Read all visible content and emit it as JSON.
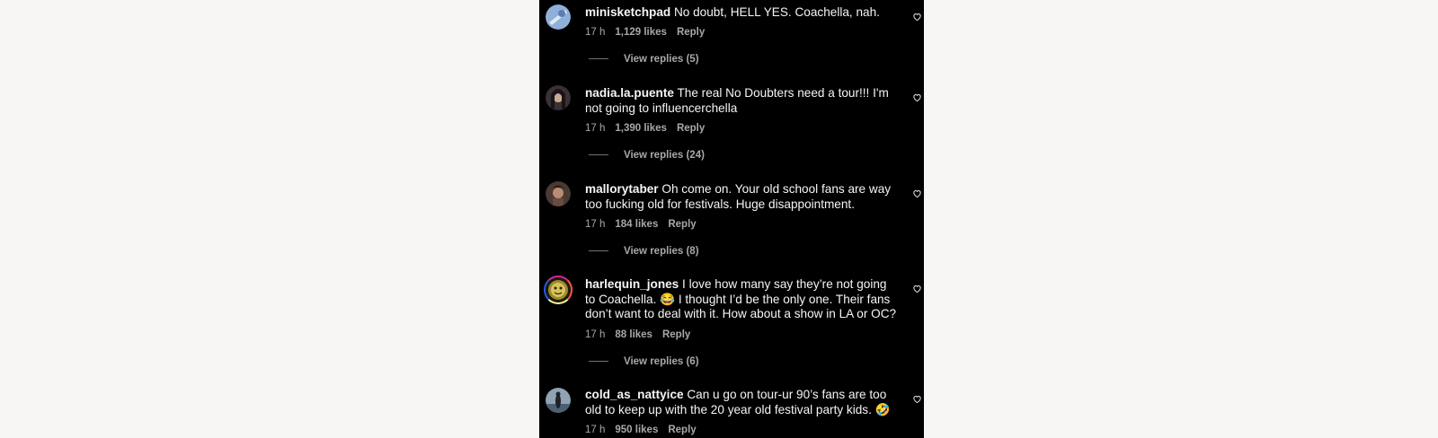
{
  "comments": [
    {
      "username": "minisketchpad",
      "text": "No doubt, HELL YES. Coachella, nah.",
      "time": "17 h",
      "likes": "1,129 likes",
      "reply": "Reply",
      "view_replies": "View replies (5)"
    },
    {
      "username": "nadia.la.puente",
      "text": "The real No Doubters need a tour!!! I'm not going to influencerchella",
      "time": "17 h",
      "likes": "1,390 likes",
      "reply": "Reply",
      "view_replies": "View replies (24)"
    },
    {
      "username": "mallorytaber",
      "text": "Oh come on. Your old school fans are way too fucking old for festivals. Huge disappointment.",
      "time": "17 h",
      "likes": "184 likes",
      "reply": "Reply",
      "view_replies": "View replies (8)"
    },
    {
      "username": "harlequin_jones",
      "text": "I love how many say they’re not going to Coachella. 😂 I thought I’d be the only one. Their fans don’t want to deal with it. How about a show in LA or OC?",
      "time": "17 h",
      "likes": "88 likes",
      "reply": "Reply",
      "view_replies": "View replies (6)"
    },
    {
      "username": "cold_as_nattyice",
      "text": "Can u go on tour-ur 90’s fans are too old to keep up with the 20 year old festival party kids. 🤣",
      "time": "17 h",
      "likes": "950 likes",
      "reply": "Reply"
    }
  ],
  "icons": {
    "like": "heart-outline-icon"
  },
  "colors": {
    "panel_bg": "#000000",
    "page_bg": "#f7f6f5",
    "text_primary": "#f5f5f5",
    "text_secondary": "#a8a8a8"
  }
}
